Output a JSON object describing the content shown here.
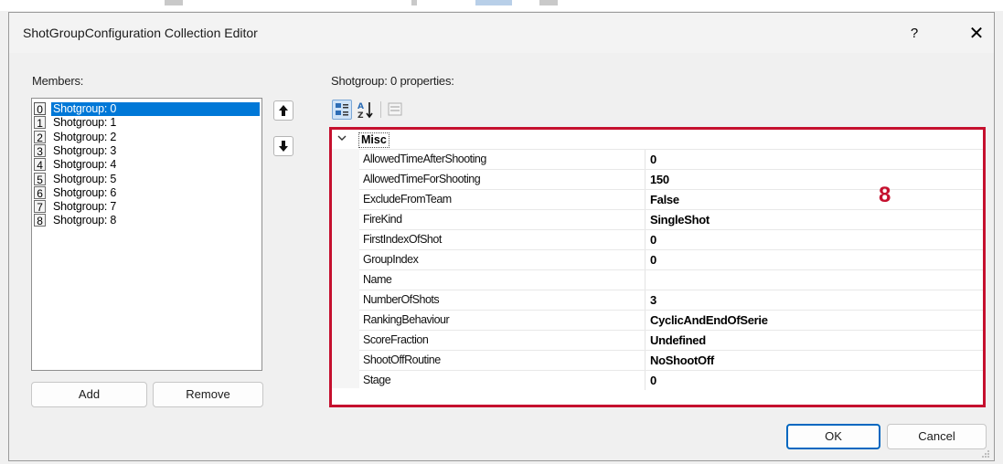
{
  "window": {
    "title": "ShotGroupConfiguration Collection Editor",
    "help": "?",
    "close": "✕"
  },
  "members": {
    "label": "Members:",
    "items": [
      {
        "index": "0",
        "name": "Shotgroup: 0",
        "selected": true
      },
      {
        "index": "1",
        "name": "Shotgroup: 1"
      },
      {
        "index": "2",
        "name": "Shotgroup: 2"
      },
      {
        "index": "3",
        "name": "Shotgroup: 3"
      },
      {
        "index": "4",
        "name": "Shotgroup: 4"
      },
      {
        "index": "5",
        "name": "Shotgroup: 5"
      },
      {
        "index": "6",
        "name": "Shotgroup: 6"
      },
      {
        "index": "7",
        "name": "Shotgroup: 7"
      },
      {
        "index": "8",
        "name": "Shotgroup: 8"
      }
    ],
    "up_icon": "🡅",
    "down_icon": "🡇",
    "add_label": "Add",
    "remove_label": "Remove"
  },
  "properties": {
    "label": "Shotgroup:  0 properties:",
    "category": "Misc",
    "rows": [
      {
        "name": "AllowedTimeAfterShooting",
        "value": "0"
      },
      {
        "name": "AllowedTimeForShooting",
        "value": "150"
      },
      {
        "name": "ExcludeFromTeam",
        "value": "False"
      },
      {
        "name": "FireKind",
        "value": "SingleShot"
      },
      {
        "name": "FirstIndexOfShot",
        "value": "0"
      },
      {
        "name": "GroupIndex",
        "value": "0"
      },
      {
        "name": "Name",
        "value": ""
      },
      {
        "name": "NumberOfShots",
        "value": "3"
      },
      {
        "name": "RankingBehaviour",
        "value": "CyclicAndEndOfSerie"
      },
      {
        "name": "ScoreFraction",
        "value": "Undefined"
      },
      {
        "name": "ShootOffRoutine",
        "value": "NoShootOff"
      },
      {
        "name": "Stage",
        "value": "0"
      }
    ],
    "annotation": "8",
    "highlight_color": "#c5102e"
  },
  "footer": {
    "ok_label": "OK",
    "cancel_label": "Cancel"
  },
  "colors": {
    "selection": "#0078d7",
    "ok_border": "#0067c0"
  }
}
